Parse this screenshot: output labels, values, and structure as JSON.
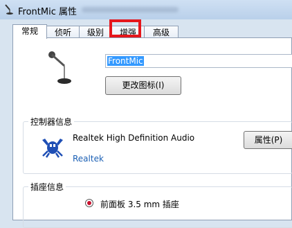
{
  "window": {
    "title": "FrontMic 属性"
  },
  "tabs": [
    {
      "label": "常规",
      "selected": true
    },
    {
      "label": "侦听",
      "selected": false
    },
    {
      "label": "级别",
      "selected": false
    },
    {
      "label": "增强",
      "selected": false
    },
    {
      "label": "高级",
      "selected": false
    }
  ],
  "device": {
    "icon": "microphone-icon",
    "name_value": "FrontMic",
    "change_icon_label": "更改图标(I)"
  },
  "controller": {
    "group_label": "控制器信息",
    "icon": "realtek-crab-icon",
    "name": "Realtek High Definition Audio",
    "vendor_link": "Realtek",
    "properties_button": "属性(P)"
  },
  "jack": {
    "group_label": "插座信息",
    "position_text": "前面板 3.5 mm 插座",
    "color": "#c8102e"
  },
  "annotation": {
    "highlight_color": "#e5161b",
    "highlight_target": "增强"
  }
}
